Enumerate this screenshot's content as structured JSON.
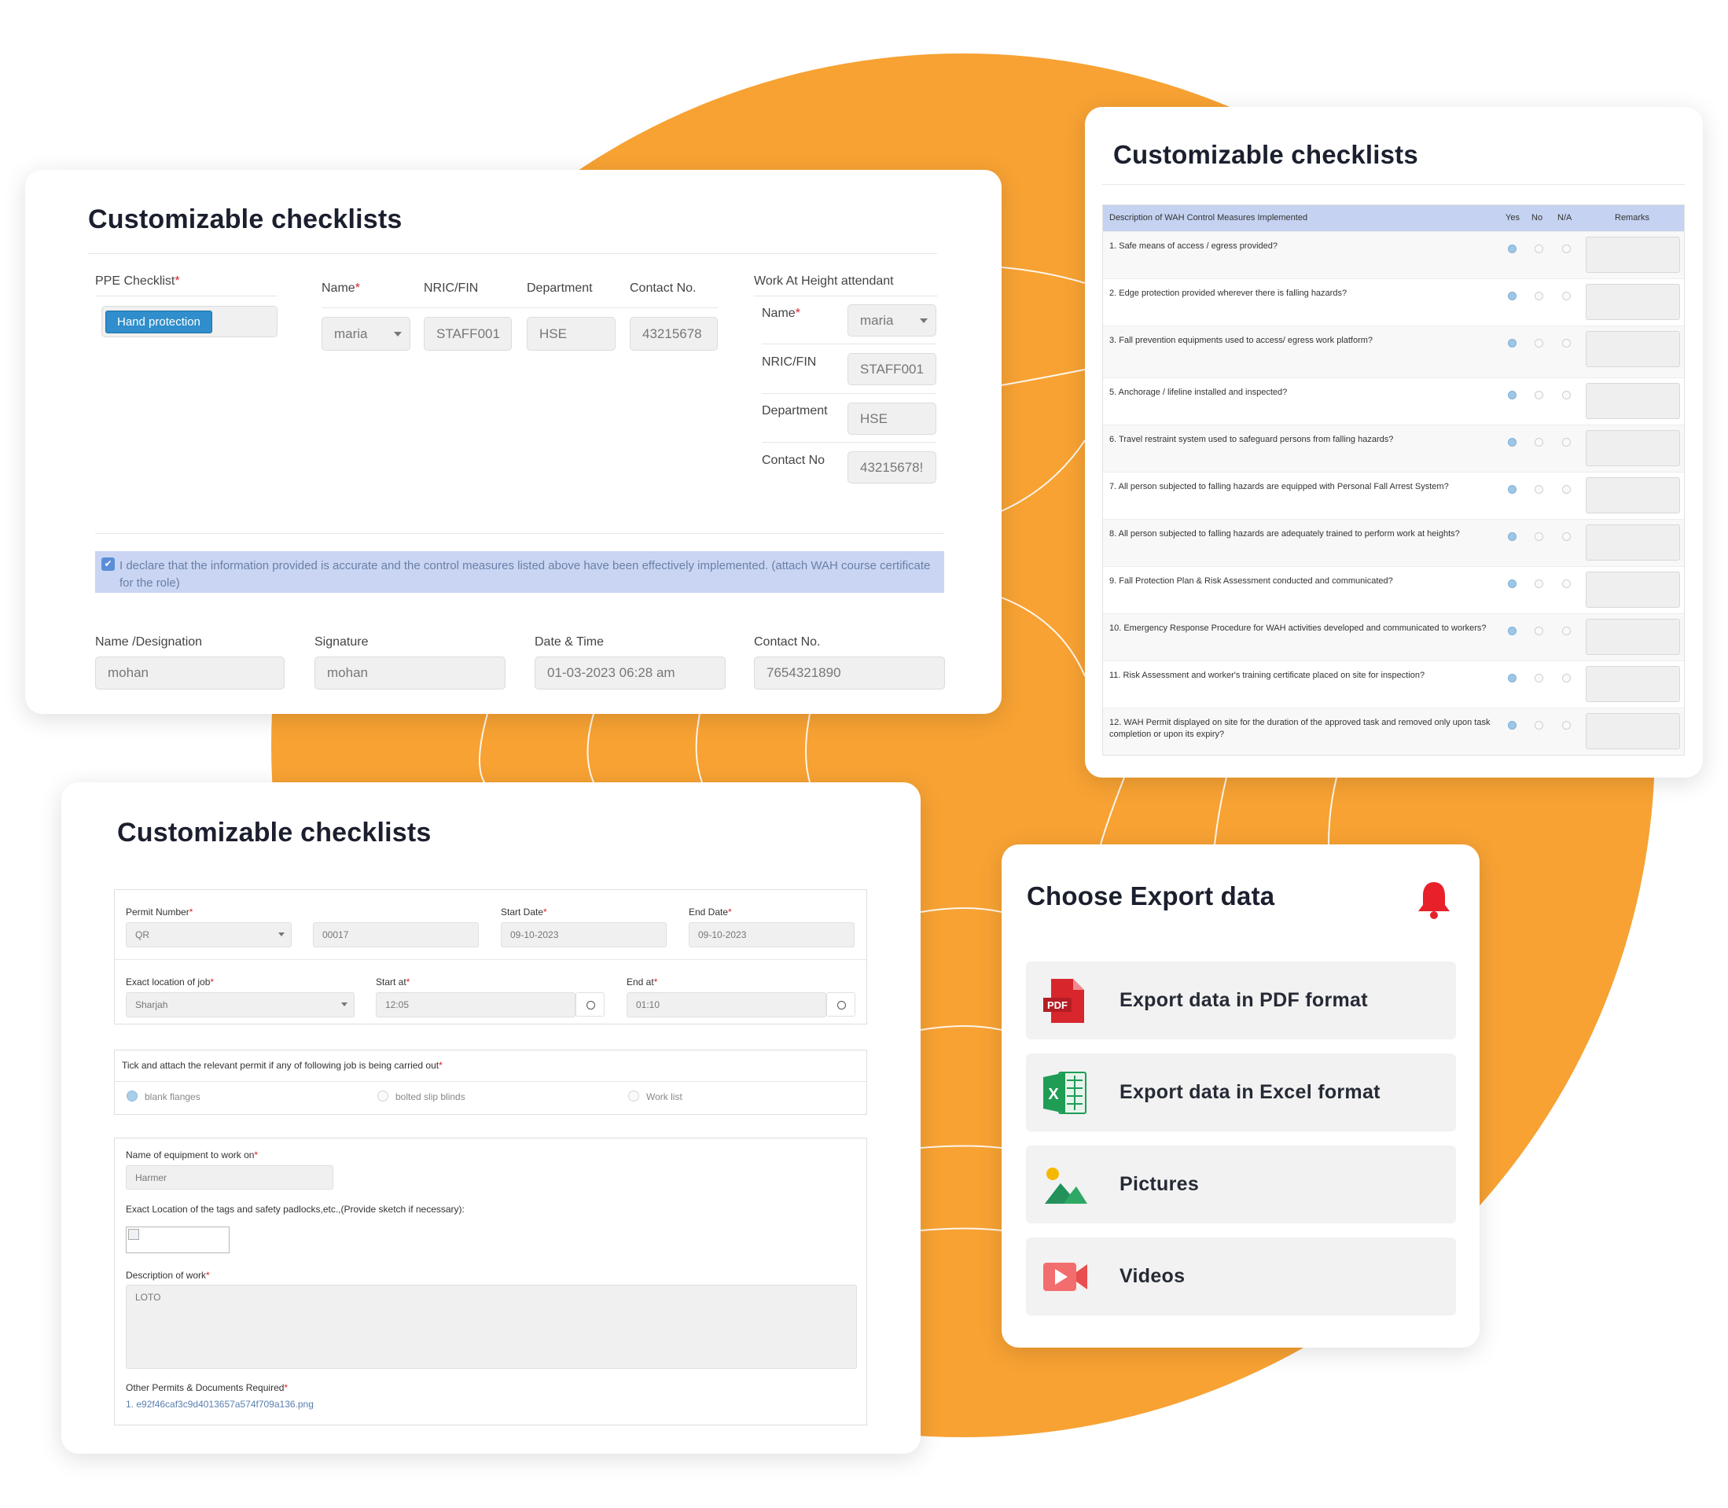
{
  "card_title": "Customizable checklists",
  "ppe_card": {
    "ppe_label": "PPE Checklist",
    "ppe_value": "Hand protection",
    "name_label": "Name",
    "name_value": "maria",
    "nric_label": "NRIC/FIN",
    "nric_value": "STAFF001",
    "dept_label": "Department",
    "dept_value": "HSE",
    "contact_label": "Contact No.",
    "contact_value": "43215678",
    "attendant_title": "Work At Height attendant",
    "att_name_label": "Name",
    "att_name_value": "maria",
    "att_nric_label": "NRIC/FIN",
    "att_nric_value": "STAFF001",
    "att_dept_label": "Department",
    "att_dept_value": "HSE",
    "att_contact_label": "Contact No",
    "att_contact_value": "43215678!",
    "declaration": "I declare that the information provided is accurate and the control measures listed above have been effectively implemented. (attach WAH course certificate for the role)",
    "sig_fields": [
      {
        "label": "Name /Designation",
        "value": "mohan"
      },
      {
        "label": "Signature",
        "value": "mohan"
      },
      {
        "label": "Date & Time",
        "value": "01-03-2023 06:28 am"
      },
      {
        "label": "Contact No.",
        "value": "7654321890"
      }
    ]
  },
  "wah_card": {
    "header": {
      "desc": "Description of WAH Control Measures Implemented",
      "yes": "Yes",
      "no": "No",
      "na": "N/A",
      "remarks": "Remarks"
    },
    "rows": [
      "1. Safe means of access / egress provided?",
      "2. Edge protection provided wherever there is falling hazards?",
      "3. Fall prevention equipments used to access/ egress work platform?",
      "5. Anchorage / lifeline installed and inspected?",
      "6. Travel restraint system used to safeguard persons from falling hazards?",
      "7. All person subjected to falling hazards are equipped with Personal Fall Arrest System?",
      "8. All person subjected to falling hazards are adequately trained to perform work at heights?",
      "9. Fall Protection Plan & Risk Assessment conducted and communicated?",
      "10. Emergency Response Procedure for WAH activities developed and communicated to workers?",
      "11. Risk Assessment and worker's training certificate placed on site for inspection?",
      "12. WAH Permit displayed on site for the duration of the approved task and removed only upon task completion or upon its expiry?"
    ]
  },
  "permit_card": {
    "permit_label": "Permit Number",
    "permit_type": "QR",
    "permit_no": "00017",
    "start_date_label": "Start Date",
    "start_date": "09-10-2023",
    "end_date_label": "End Date",
    "end_date": "09-10-2023",
    "location_label": "Exact location of job",
    "location": "Sharjah",
    "start_at_label": "Start at",
    "start_at": "12:05",
    "end_at_label": "End at",
    "end_at": "01:10",
    "tick_label": "Tick and attach the relevant permit if any of following job is being carried out",
    "options": [
      "blank flanges",
      "bolted slip blinds",
      "Work list"
    ],
    "equip_label": "Name of equipment to work on",
    "equip_value": "Harmer",
    "tags_label": "Exact Location of the tags and safety padlocks,etc.,(Provide sketch if necessary):",
    "desc_label": "Description of work",
    "desc_value": "LOTO",
    "other_label": "Other Permits & Documents Required",
    "other_file": "1. e92f46caf3c9d4013657a574f709a136.png"
  },
  "export_card": {
    "title": "Choose Export data",
    "items": [
      {
        "label": "Export data in PDF format",
        "icon": "pdf-icon",
        "badge": "PDF"
      },
      {
        "label": "Export data in Excel format",
        "icon": "excel-icon",
        "badge": "X"
      },
      {
        "label": "Pictures",
        "icon": "picture-icon"
      },
      {
        "label": "Videos",
        "icon": "video-icon"
      }
    ]
  },
  "colors": {
    "accent_orange": "#f7a233",
    "bell_red": "#e8202a",
    "pdf_red": "#d8262d",
    "excel_green": "#1f9d55",
    "video_red": "#e84e4e",
    "highlight_blue": "#c5d2f1"
  }
}
